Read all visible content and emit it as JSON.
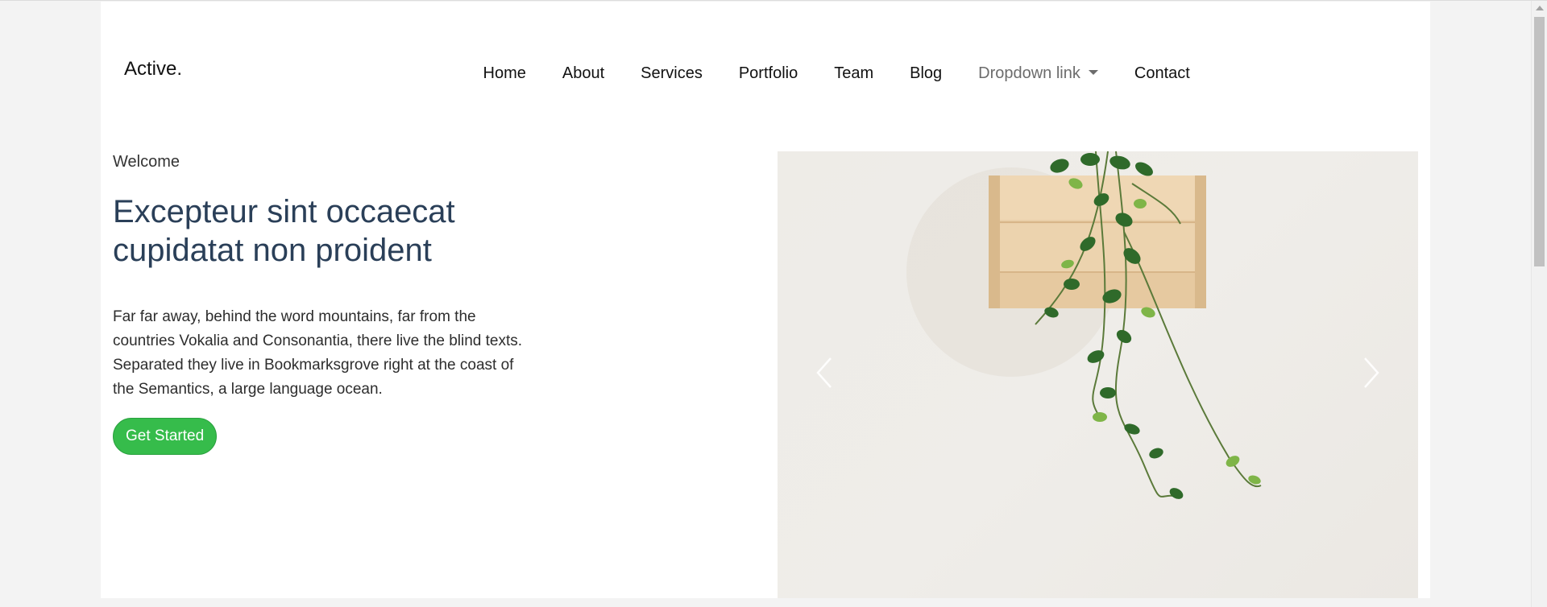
{
  "brand": {
    "name": "Active."
  },
  "nav": {
    "items": [
      {
        "label": "Home"
      },
      {
        "label": "About"
      },
      {
        "label": "Services"
      },
      {
        "label": "Portfolio"
      },
      {
        "label": "Team"
      },
      {
        "label": "Blog"
      },
      {
        "label": "Dropdown link"
      },
      {
        "label": "Contact"
      }
    ]
  },
  "hero": {
    "eyebrow": "Welcome",
    "headline_line1": "Excepteur sint occaecat",
    "headline_line2": "cupidatat non proident",
    "lead": "Far far away, behind the word mountains, far from the countries Vokalia and Consonantia, there live the blind texts. Separated they live in Bookmarksgrove right at the coast of the Semantics, a large language ocean.",
    "cta_label": "Get Started"
  },
  "carousel": {
    "prev_icon": "chevron-left-icon",
    "next_icon": "chevron-right-icon"
  },
  "colors": {
    "accent": "#36bc4b",
    "headline": "#2a3f58",
    "dropdown_text": "#6c6c6c"
  }
}
